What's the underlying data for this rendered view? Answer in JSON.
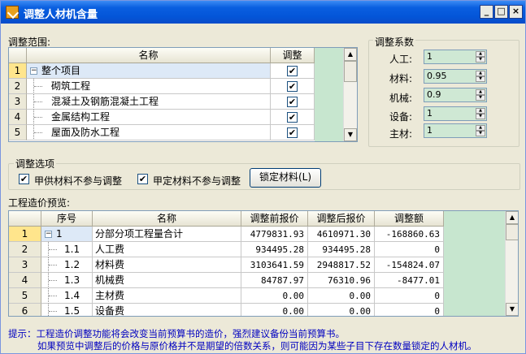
{
  "window": {
    "title": "调整人材机含量",
    "min": "_",
    "max": "□",
    "close": "×"
  },
  "scope": {
    "label": "调整范围:",
    "columns": [
      "名称",
      "调整"
    ],
    "rows": [
      {
        "num": "1",
        "name": "整个项目",
        "checked": "✔",
        "tree": "−"
      },
      {
        "num": "2",
        "name": "砌筑工程",
        "checked": "✔"
      },
      {
        "num": "3",
        "name": "混凝土及钢筋混凝土工程",
        "checked": "✔"
      },
      {
        "num": "4",
        "name": "金属结构工程",
        "checked": "✔"
      },
      {
        "num": "5",
        "name": "屋面及防水工程",
        "checked": "✔"
      }
    ]
  },
  "coef": {
    "label": "调整系数",
    "items": [
      {
        "label": "人工:",
        "value": "1"
      },
      {
        "label": "材料:",
        "value": "0.95"
      },
      {
        "label": "机械:",
        "value": "0.9"
      },
      {
        "label": "设备:",
        "value": "1"
      },
      {
        "label": "主材:",
        "value": "1"
      }
    ]
  },
  "options": {
    "label": "调整选项",
    "opt1": "甲供材料不参与调整",
    "opt2": "甲定材料不参与调整",
    "check": "✔",
    "lock_button": "锁定材料(L)"
  },
  "preview": {
    "label": "工程造价预览:",
    "columns": [
      "序号",
      "名称",
      "调整前报价",
      "调整后报价",
      "调整额"
    ],
    "rows": [
      {
        "num": "1",
        "seq": "1",
        "name": "分部分项工程量合计",
        "before": "4779831.93",
        "after": "4610971.30",
        "diff": "-168860.63",
        "tree": "−"
      },
      {
        "num": "2",
        "seq": "1.1",
        "name": "人工费",
        "before": "934495.28",
        "after": "934495.28",
        "diff": "0"
      },
      {
        "num": "3",
        "seq": "1.2",
        "name": "材料费",
        "before": "3103641.59",
        "after": "2948817.52",
        "diff": "-154824.07"
      },
      {
        "num": "4",
        "seq": "1.3",
        "name": "机械费",
        "before": "84787.97",
        "after": "76310.96",
        "diff": "-8477.01"
      },
      {
        "num": "5",
        "seq": "1.4",
        "name": "主材费",
        "before": "0.00",
        "after": "0.00",
        "diff": "0"
      },
      {
        "num": "6",
        "seq": "1.5",
        "name": "设备费",
        "before": "0.00",
        "after": "0.00",
        "diff": "0"
      }
    ]
  },
  "tip": {
    "line1": "提示：工程造价调整功能将会改变当前预算书的造价，强烈建议备份当前预算书。",
    "line2": "如果预览中调整后的价格与原价格并不是期望的倍数关系，则可能因为某些子目下存在数量锁定的人材机。"
  },
  "colors": {
    "title_bar": "#0355D8",
    "green_panel": "#C7E6CF",
    "selected_row": "#FFE58C",
    "tip_text": "#0000C0"
  }
}
